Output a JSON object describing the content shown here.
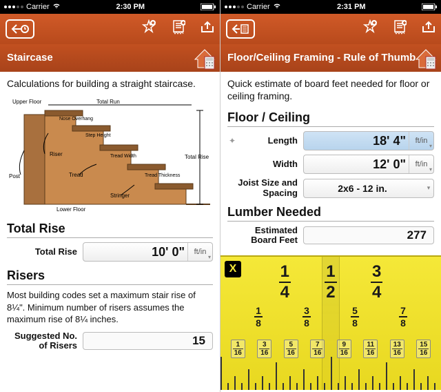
{
  "left": {
    "status": {
      "carrier": "Carrier",
      "time": "2:30 PM"
    },
    "title": "Staircase",
    "desc": "Calculations for building a straight staircase.",
    "diagram_labels": {
      "upper_floor": "Upper Floor",
      "total_run": "Total Run",
      "nose_overhang": "Nose Overhang",
      "step_height": "Step Height",
      "riser": "Riser",
      "tread_width": "Tread Width",
      "tread": "Tread",
      "tread_thickness": "Tread Thickness",
      "post": "Post",
      "stringer": "Stringer",
      "lower_floor": "Lower Floor",
      "total_rise": "Total Rise"
    },
    "total_rise_head": "Total Rise",
    "total_rise_label": "Total Rise",
    "total_rise_value": "10' 0\"",
    "total_rise_unit": "ft/in",
    "risers_head": "Risers",
    "risers_note": "Most building codes set a maximum stair rise of 8¼\". Minimum number of risers assumes the maximum rise of 8¼ inches.",
    "suggested_label": "Suggested No. of Risers",
    "suggested_value": "15"
  },
  "right": {
    "status": {
      "carrier": "Carrier",
      "time": "2:31 PM"
    },
    "title": "Floor/Ceiling Framing - Rule of Thumb",
    "desc": "Quick estimate of board feet needed for floor or ceiling framing.",
    "fc_head": "Floor / Ceiling",
    "length_label": "Length",
    "length_value": "18' 4\"",
    "length_unit": "ft/in",
    "width_label": "Width",
    "width_value": "12' 0\"",
    "width_unit": "ft/in",
    "joist_label": "Joist Size and Spacing",
    "joist_value": "2x6 - 12 in.",
    "lumber_head": "Lumber Needed",
    "boardfeet_label": "Estimated Board Feet",
    "boardfeet_value": "277",
    "ruler": {
      "close": "X",
      "quarters": [
        {
          "n": "1",
          "d": "4"
        },
        {
          "n": "1",
          "d": "2"
        },
        {
          "n": "3",
          "d": "4"
        }
      ],
      "eighths": [
        {
          "n": "1",
          "d": "8"
        },
        {
          "n": "3",
          "d": "8"
        },
        {
          "n": "5",
          "d": "8"
        },
        {
          "n": "7",
          "d": "8"
        }
      ],
      "sixteenths": [
        {
          "n": "1",
          "d": "16"
        },
        {
          "n": "3",
          "d": "16"
        },
        {
          "n": "5",
          "d": "16"
        },
        {
          "n": "7",
          "d": "16"
        },
        {
          "n": "9",
          "d": "16"
        },
        {
          "n": "11",
          "d": "16"
        },
        {
          "n": "13",
          "d": "16"
        },
        {
          "n": "15",
          "d": "16"
        }
      ]
    }
  }
}
